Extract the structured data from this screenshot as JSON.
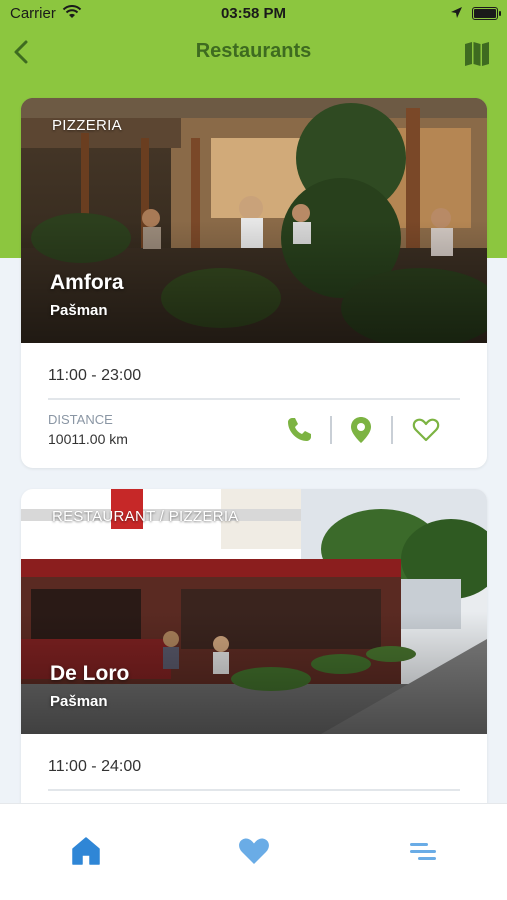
{
  "status_bar": {
    "carrier": "Carrier",
    "time": "03:58 PM"
  },
  "nav": {
    "title": "Restaurants",
    "back_icon": "chevron-left-icon",
    "map_icon": "map-icon"
  },
  "restaurants": [
    {
      "category": "PIZZERIA",
      "name": "Amfora",
      "place": "Pašman",
      "hours": "11:00 - 23:00",
      "distance_label": "DISTANCE",
      "distance": "10011.00 km"
    },
    {
      "category": "RESTAURANT / PIZZERIA",
      "name": "De Loro",
      "place": "Pašman",
      "hours": "11:00 - 24:00"
    }
  ],
  "tabs": [
    {
      "icon": "home-icon",
      "active": true
    },
    {
      "icon": "heart-icon",
      "active": false
    },
    {
      "icon": "list-icon",
      "active": false
    }
  ],
  "colors": {
    "header_green": "#8cc63f",
    "title_green": "#3e6b20",
    "action_green": "#7cb342",
    "tab_blue": "#2f86d6",
    "tab_light_blue": "#6aace6"
  }
}
